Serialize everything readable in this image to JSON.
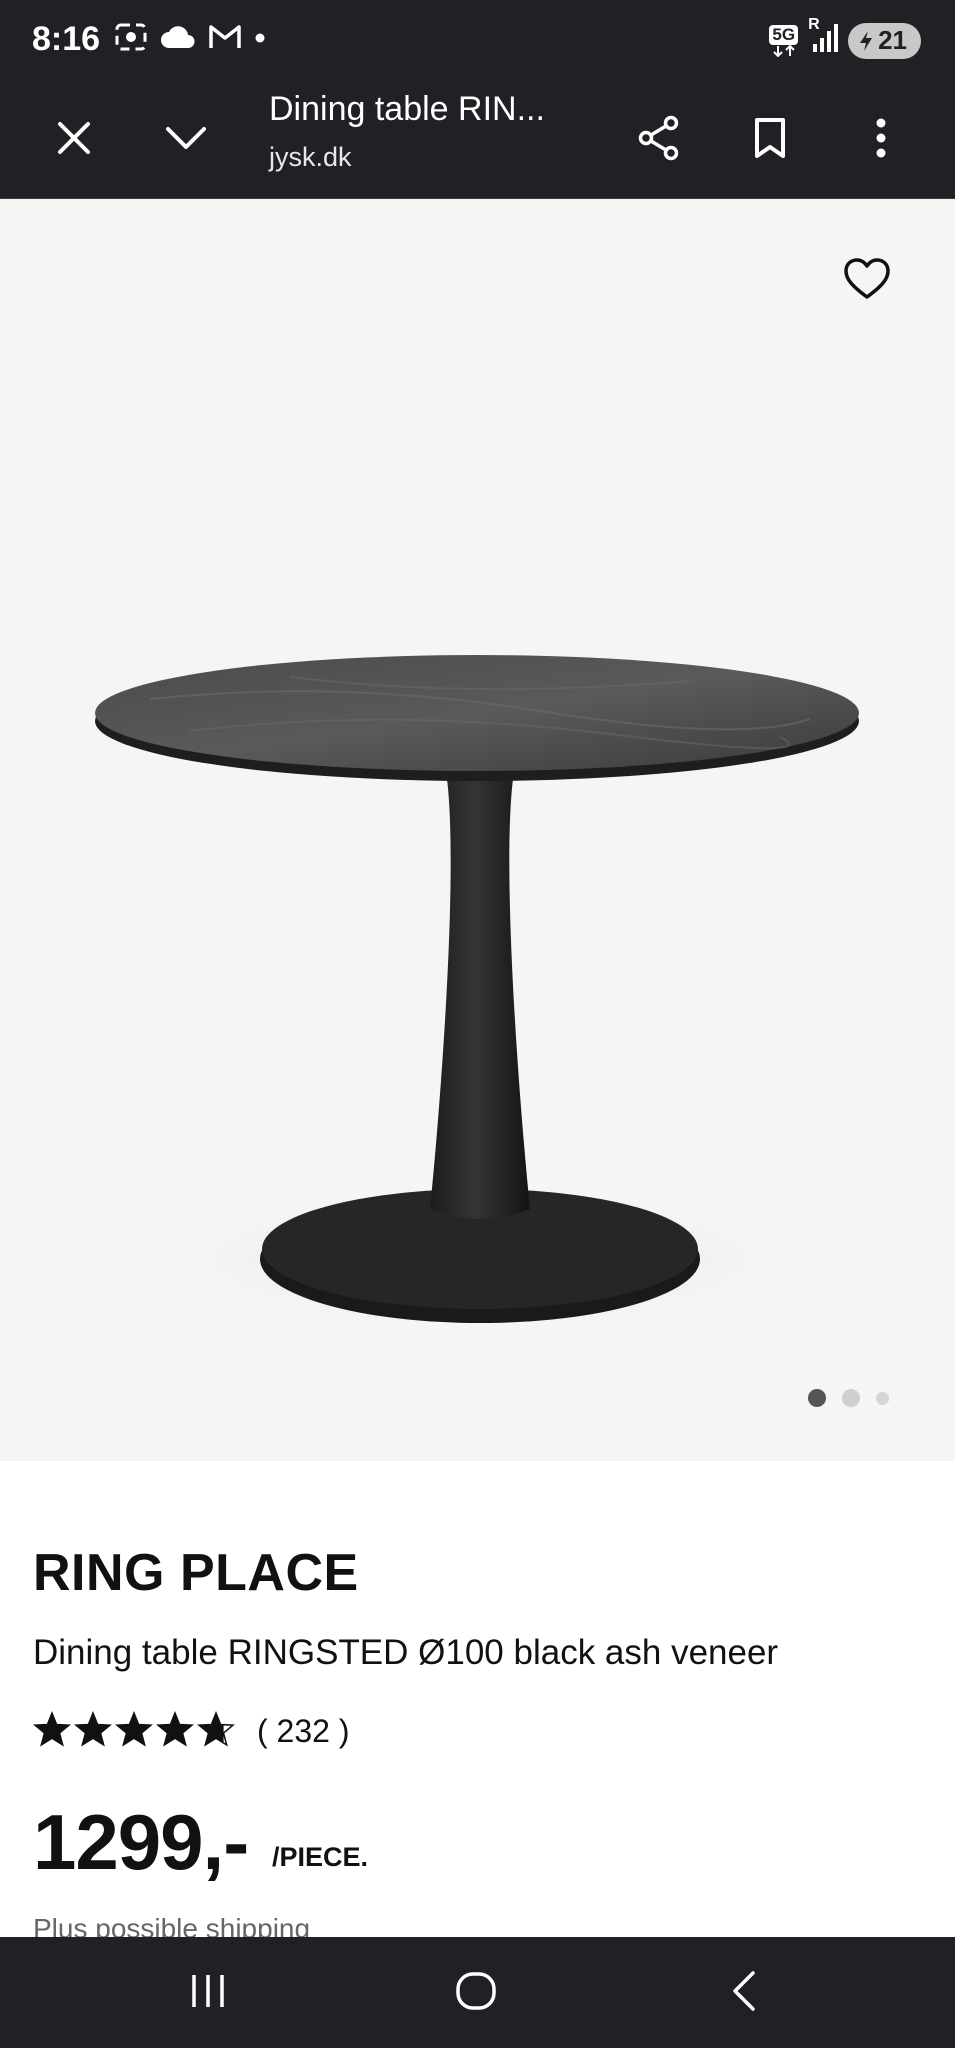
{
  "status_bar": {
    "time": "8:16",
    "network": "5G",
    "roaming": "R",
    "battery": "21",
    "icons": [
      "screenshot-icon",
      "cloud-icon",
      "gmail-icon",
      "notification-dot-icon",
      "5g-icon",
      "signal-icon",
      "battery-icon"
    ]
  },
  "browser": {
    "title": "Dining table RIN...",
    "url": "jysk.dk",
    "icons": [
      "close-icon",
      "chevron-down-icon",
      "share-icon",
      "bookmark-icon",
      "more-vert-icon"
    ]
  },
  "gallery": {
    "image_count": 3,
    "active_index": 0,
    "icons": [
      "heart-icon"
    ]
  },
  "product": {
    "brand": "RING PLACE",
    "name": "Dining table RINGSTED Ø100 black ash veneer",
    "rating": 4.7,
    "rating_max": 5,
    "review_count": "( 232 )",
    "price": "1299,-",
    "unit": "/PIECE.",
    "shipping_note": "Plus possible shipping"
  },
  "nav": {
    "icons": [
      "recents-icon",
      "home-icon",
      "back-icon"
    ]
  },
  "colors": {
    "bar_dark": "#202124",
    "hero_bg": "#f5f5f4",
    "text": "#111111"
  }
}
